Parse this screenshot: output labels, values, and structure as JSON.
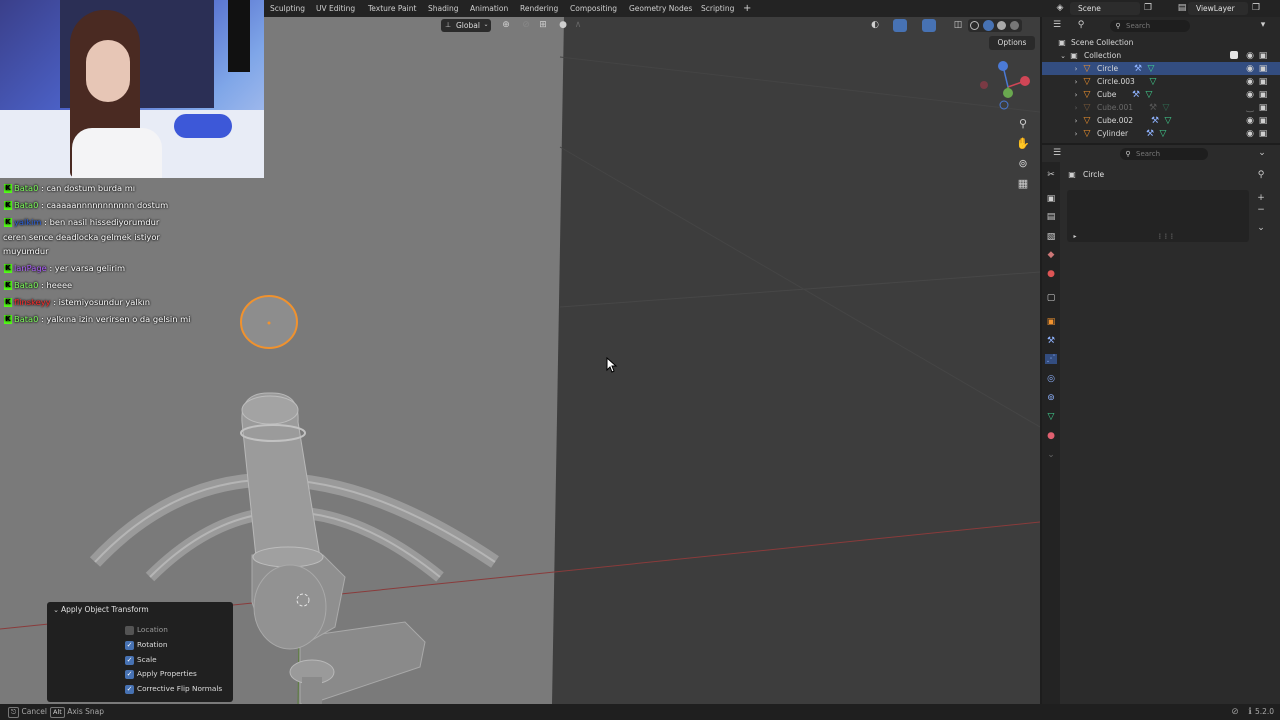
{
  "workspace_tabs": [
    "Sculpting",
    "UV Editing",
    "Texture Paint",
    "Shading",
    "Animation",
    "Rendering",
    "Compositing",
    "Geometry Nodes",
    "Scripting",
    "+"
  ],
  "scene": {
    "label": "Scene"
  },
  "view_layer": {
    "label": "ViewLayer"
  },
  "viewport": {
    "transform_orientation": "Global",
    "options_label": "Options"
  },
  "chat": [
    {
      "user": "Bata0",
      "message": ": can dostum burda mı",
      "user_color": "#7cfc5a"
    },
    {
      "user": "Bata0",
      "message": ": caaaaannnnnnnnnnn dostum",
      "user_color": "#7cfc5a"
    },
    {
      "user": "yalkim",
      "message": ": ben nasil hissediyorumdur",
      "user_color": "#2b5ed6"
    },
    {
      "user": "",
      "message": "ceren sence deadlocka gelmek istiyor",
      "user_color": "#ffffff"
    },
    {
      "user": "",
      "message": "muyumdur",
      "user_color": "#ffffff"
    },
    {
      "user": "lanPage",
      "message": ": yer varsa gelirim",
      "user_color": "#b060ff"
    },
    {
      "user": "Bata0",
      "message": ": heeee",
      "user_color": "#7cfc5a"
    },
    {
      "user": "flinskeyy",
      "message": ": istemiyosundur yalkın",
      "user_color": "#ff2a2a"
    },
    {
      "user": "Bata0",
      "message": ": yalkına izin verirsen o da gelsin mi",
      "user_color": "#7cfc5a"
    }
  ],
  "operator_panel": {
    "title": "Apply Object Transform",
    "options": [
      {
        "label": "Location",
        "checked": false
      },
      {
        "label": "Rotation",
        "checked": true
      },
      {
        "label": "Scale",
        "checked": true
      },
      {
        "label": "Apply Properties",
        "checked": true
      },
      {
        "label": "Corrective Flip Normals",
        "checked": true
      }
    ]
  },
  "outliner": {
    "search_placeholder": "Search",
    "scene_collection": "Scene Collection",
    "collection": "Collection",
    "objects": [
      {
        "name": "Circle",
        "selected": true,
        "dimmed": false
      },
      {
        "name": "Circle.003",
        "selected": false,
        "dimmed": false
      },
      {
        "name": "Cube",
        "selected": false,
        "dimmed": false
      },
      {
        "name": "Cube.001",
        "selected": false,
        "dimmed": true
      },
      {
        "name": "Cube.002",
        "selected": false,
        "dimmed": false
      },
      {
        "name": "Cylinder",
        "selected": false,
        "dimmed": false
      }
    ]
  },
  "properties": {
    "search_placeholder": "Search",
    "object_name": "Circle"
  },
  "statusbar": {
    "cancel_label": "Cancel",
    "alt_key": "Alt",
    "axis_snap_label": "Axis Snap",
    "version": "5.2.0"
  },
  "colors": {
    "accent_blue": "#4772b3",
    "viewport_bg": "#3d3d3d",
    "selection_orange": "#f0922e"
  }
}
